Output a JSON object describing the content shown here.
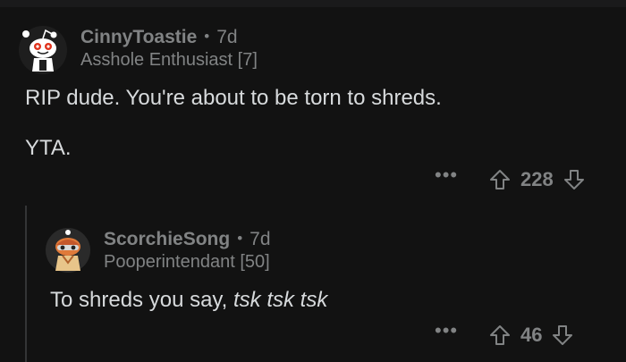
{
  "comments": [
    {
      "username": "CinnyToastie",
      "separator": "•",
      "age": "7d",
      "flair": "Asshole Enthusiast [7]",
      "paragraphs": [
        "RIP dude. You're about to be torn to shreds.",
        "YTA."
      ],
      "more_label": "•••",
      "score": "228",
      "avatar_icon": "snoo-avatar-icon"
    },
    {
      "username": "ScorchieSong",
      "separator": "•",
      "age": "7d",
      "flair": "Pooperintendant [50]",
      "text_plain": "To shreds you say, ",
      "text_italic": "tsk tsk tsk",
      "more_label": "•••",
      "score": "46",
      "avatar_icon": "snoo-avatar-icon"
    }
  ],
  "colors": {
    "background": "#121212",
    "text": "#d7dadc",
    "muted": "#818384",
    "thread_line": "#343536"
  }
}
